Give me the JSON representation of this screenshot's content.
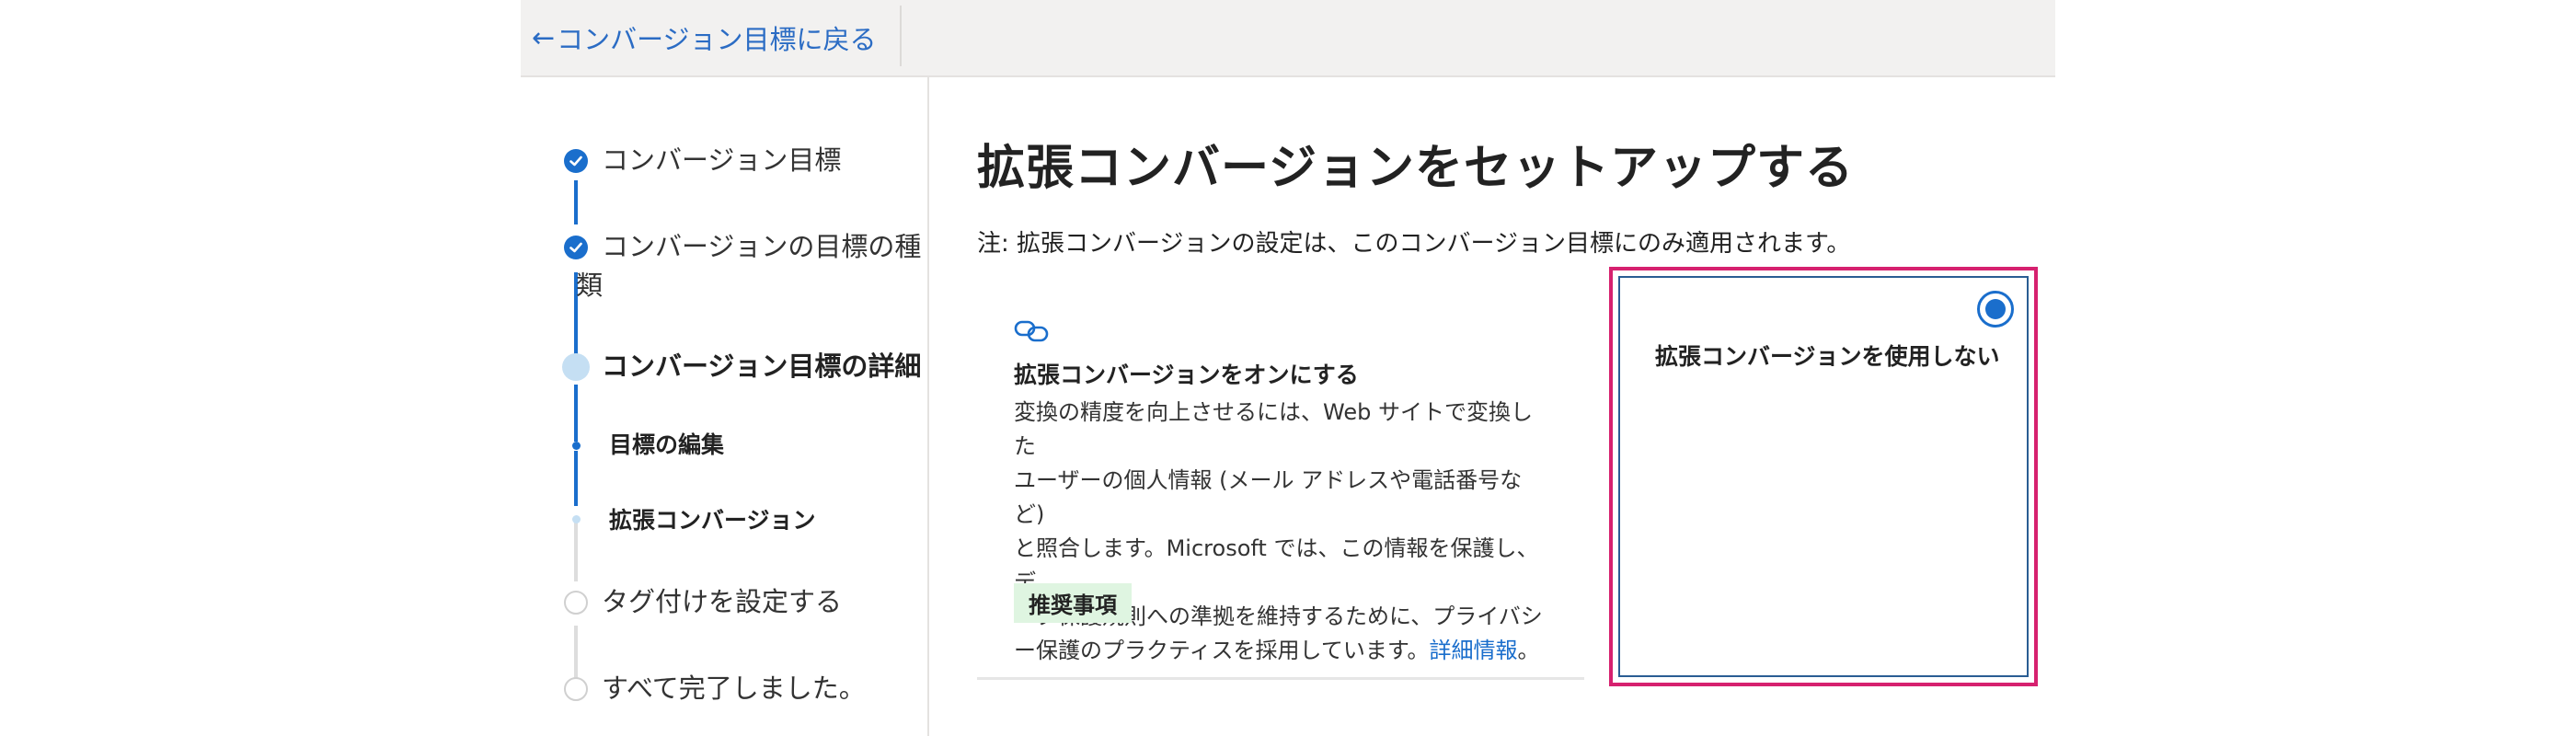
{
  "header": {
    "back_arrow": "←",
    "back_label": "コンバージョン目標に戻る"
  },
  "stepper": {
    "steps": [
      {
        "label": "コンバージョン目標",
        "state": "done"
      },
      {
        "label_line1": "コンバージョンの目標の種",
        "label_line2": "類",
        "state": "done"
      },
      {
        "label": "コンバージョン目標の詳細",
        "state": "current"
      },
      {
        "label": "目標の編集",
        "state": "sub-done"
      },
      {
        "label": "拡張コンバージョン",
        "state": "sub-current"
      },
      {
        "label": "タグ付けを設定する",
        "state": "pending"
      },
      {
        "label": "すべて完了しました。",
        "state": "pending"
      }
    ]
  },
  "main": {
    "title": "拡張コンバージョンをセットアップする",
    "note": "注: 拡張コンバージョンの設定は、このコンバージョン目標にのみ適用されます。",
    "option_on": {
      "icon": "link-icon",
      "title": "拡張コンバージョンをオンにする",
      "desc_lines": [
        "変換の精度を向上させるには、Web サイトで変換した",
        "ユーザーの個人情報 (メール アドレスや電話番号など)",
        "と照合します。Microsoft では、この情報を保護し、デ",
        "ータ保護規則への準拠を維持するために、プライバシ",
        "ー保護のプラクティスを採用しています。"
      ],
      "learn_more": "詳細情報",
      "desc_end": "。",
      "badge": "推奨事項",
      "selected": false
    },
    "option_off": {
      "title": "拡張コンバージョンを使用しない",
      "selected": true
    }
  },
  "colors": {
    "accent": "#1a6ecc",
    "highlight_outline": "#d6216f",
    "selected_border": "#2a5d93",
    "badge_bg": "#dff5e1",
    "current_step": "#c5dff3"
  }
}
